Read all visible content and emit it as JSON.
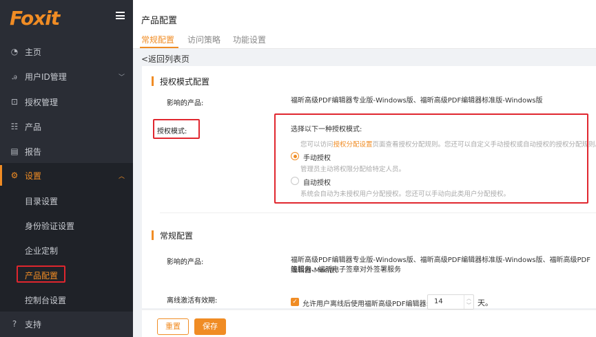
{
  "logo": {
    "text": "Foxit"
  },
  "sidebar": {
    "items": [
      {
        "label": "主页",
        "icon": "dashboard-icon"
      },
      {
        "label": "用户ID管理",
        "icon": "users-icon"
      },
      {
        "label": "授权管理",
        "icon": "license-icon"
      },
      {
        "label": "产品",
        "icon": "product-icon"
      },
      {
        "label": "报告",
        "icon": "report-icon"
      },
      {
        "label": "设置",
        "icon": "gear-icon"
      },
      {
        "label": "支持",
        "icon": "help-icon"
      }
    ],
    "sub_items": [
      {
        "label": "目录设置"
      },
      {
        "label": "身份验证设置"
      },
      {
        "label": "企业定制"
      },
      {
        "label": "产品配置"
      },
      {
        "label": "控制台设置"
      }
    ]
  },
  "header": {
    "title": "产品配置",
    "tabs": [
      {
        "label": "常规配置"
      },
      {
        "label": "访问策略"
      },
      {
        "label": "功能设置"
      }
    ],
    "back_label": "<返回列表页"
  },
  "license_section": {
    "title": "授权模式配置",
    "affected_label": "影响的产品:",
    "affected_value": "福昕高级PDF编辑器专业版-Windows版、福昕高级PDF编辑器标准版-Windows版",
    "mode_label": "授权模式:",
    "choose_text": "选择以下一种授权模式:",
    "hint_prefix": "您可以访问",
    "hint_link": "授权分配设置",
    "hint_suffix": "页面查看授权分配规则。您还可以自定义手动授权或自动授权的授权分配规则。",
    "options": [
      {
        "label": "手动授权",
        "desc": "管理员主动将权限分配给特定人员。",
        "selected": true
      },
      {
        "label": "自动授权",
        "desc": "系统会自动为未授权用户分配授权。您还可以手动向此类用户分配授权。",
        "selected": false
      }
    ]
  },
  "general_section": {
    "title": "常规配置",
    "affected_label": "影响的产品:",
    "affected_value_line1": "福昕高级PDF编辑器专业版-Windows版、福昕高级PDF编辑器标准版-Windows版、福昕高级PDF编辑器-Mac版、",
    "affected_value_line2": "签服务、福昕电子签章对外签署服务",
    "offline_label": "离线激活有效期:",
    "offline_checkbox_label": "允许用户离线后使用福昕高级PDF编辑器:",
    "offline_checked": true,
    "offline_days": "14",
    "offline_unit": "天。"
  },
  "footer": {
    "reset_label": "重置",
    "save_label": "保存"
  },
  "colors": {
    "accent": "#f08c24",
    "sidebar_bg": "#2a2d35",
    "highlight": "#e0262e"
  }
}
